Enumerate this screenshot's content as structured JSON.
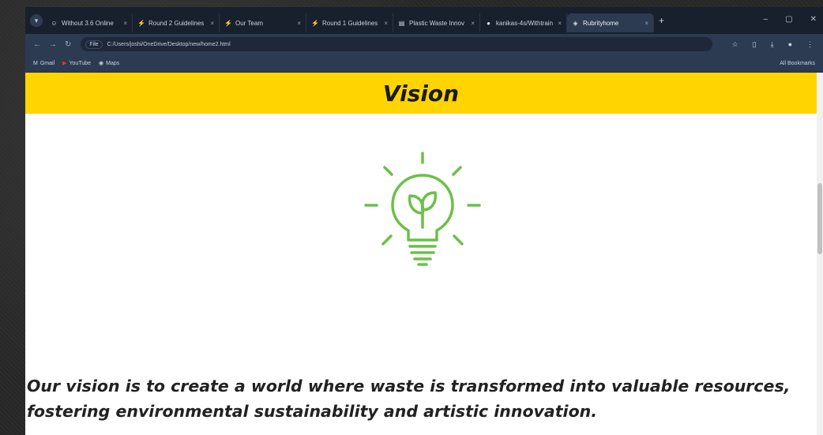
{
  "browser": {
    "tabs": [
      {
        "label": "Without 3.6 Online",
        "icon": "hf-icon",
        "active": false
      },
      {
        "label": "Round 2 Guidelines",
        "icon": "bolt-icon",
        "active": false
      },
      {
        "label": "Our Team",
        "icon": "bolt-icon",
        "active": false
      },
      {
        "label": "Round 1 Guidelines",
        "icon": "bolt-icon",
        "active": false
      },
      {
        "label": "Plastic Waste Innov",
        "icon": "doc-icon",
        "active": false
      },
      {
        "label": "kanikas-4s/Withtrain",
        "icon": "github-icon",
        "active": false
      },
      {
        "label": "Rubrityhome",
        "icon": "page-icon",
        "active": true
      }
    ],
    "close_glyph": "×",
    "new_tab_glyph": "+",
    "url_chip": "File",
    "url": "C:/Users/joshi/OneDrive/Desktop/new/home2.html",
    "bookmarks": [
      {
        "label": "Gmail",
        "icon": "gmail-icon"
      },
      {
        "label": "YouTube",
        "icon": "youtube-icon"
      },
      {
        "label": "Maps",
        "icon": "maps-icon"
      }
    ],
    "all_bookmarks": "All Bookmarks"
  },
  "page": {
    "heading": "Vision",
    "vision_text": "Our vision is to create a world where waste is transformed into valuable resources, fostering environmental sustainability and artistic innovation."
  },
  "colors": {
    "banner": "#ffd400",
    "bulb": "#6cc04a",
    "browser_frame": "#2c3a52"
  }
}
